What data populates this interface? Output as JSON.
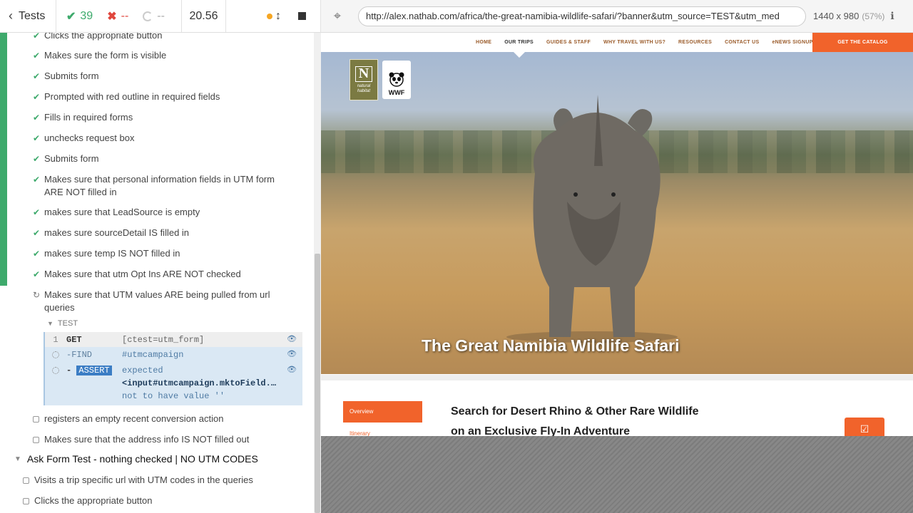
{
  "header": {
    "back_label": "Tests",
    "passed": "39",
    "failed": "--",
    "pending": "--",
    "duration": "20.56"
  },
  "aut_bar": {
    "url": "http://alex.nathab.com/africa/the-great-namibia-wildlife-safari/?banner&utm_source=TEST&utm_med",
    "viewport": "1440 x 980",
    "scale": "(57%)"
  },
  "tests": [
    {
      "text": "Clicks the appropriate button",
      "state": "passed"
    },
    {
      "text": "Makes sure the form is visible",
      "state": "passed"
    },
    {
      "text": "Submits form",
      "state": "passed"
    },
    {
      "text": "Prompted with red outline in required fields",
      "state": "passed"
    },
    {
      "text": "Fills in required forms",
      "state": "passed"
    },
    {
      "text": "unchecks request box",
      "state": "passed"
    },
    {
      "text": "Submits form",
      "state": "passed"
    },
    {
      "text": "Makes sure that personal information fields in UTM form ARE NOT filled in",
      "state": "passed"
    },
    {
      "text": "makes sure that LeadSource is empty",
      "state": "passed"
    },
    {
      "text": "makes sure sourceDetail IS filled in",
      "state": "passed"
    },
    {
      "text": "makes sure temp IS NOT filled in",
      "state": "passed"
    },
    {
      "text": "Makes sure that utm Opt Ins ARE NOT checked",
      "state": "passed"
    },
    {
      "text": "Makes sure that UTM values ARE being pulled from url queries",
      "state": "running"
    }
  ],
  "test_section_label": "TEST",
  "commands": [
    {
      "num": "1",
      "name": "GET",
      "message": "[ctest=utm_form]"
    },
    {
      "num": "",
      "name": "-FIND",
      "message": "#utmcampaign"
    },
    {
      "num": "",
      "name": "ASSERT",
      "msg_a": "expected",
      "msg_b": "<input#utmcampaign.mktoField.…",
      "msg_c": "not to have value ''"
    }
  ],
  "pending_tests": [
    "registers an empty recent conversion action",
    "Makes sure that the address info IS NOT filled out"
  ],
  "suite": {
    "title": "Ask Form Test - nothing checked | NO UTM CODES",
    "tests": [
      "Visits a trip specific url with UTM codes in the queries",
      "Clicks the appropriate button"
    ]
  },
  "site": {
    "nav": [
      "HOME",
      "OUR TRIPS",
      "GUIDES & STAFF",
      "WHY TRAVEL WITH US?",
      "RESOURCES",
      "CONTACT US",
      "eNEWS SIGNUP"
    ],
    "catalog": "GET THE CATALOG",
    "logo_n": "N",
    "logo_text": "natural habitat",
    "wwf": "WWF",
    "hero_title": "The Great Namibia Wildlife Safari",
    "side_active": "Overview",
    "side_next": "Itinerary",
    "heading": "Search for Desert Rhino & Other Rare Wildlife on an Exclusive Fly-In Adventure"
  },
  "colors": {
    "pass": "#3eaa6c",
    "fail": "#e0473e",
    "brand": "#f1632b"
  }
}
